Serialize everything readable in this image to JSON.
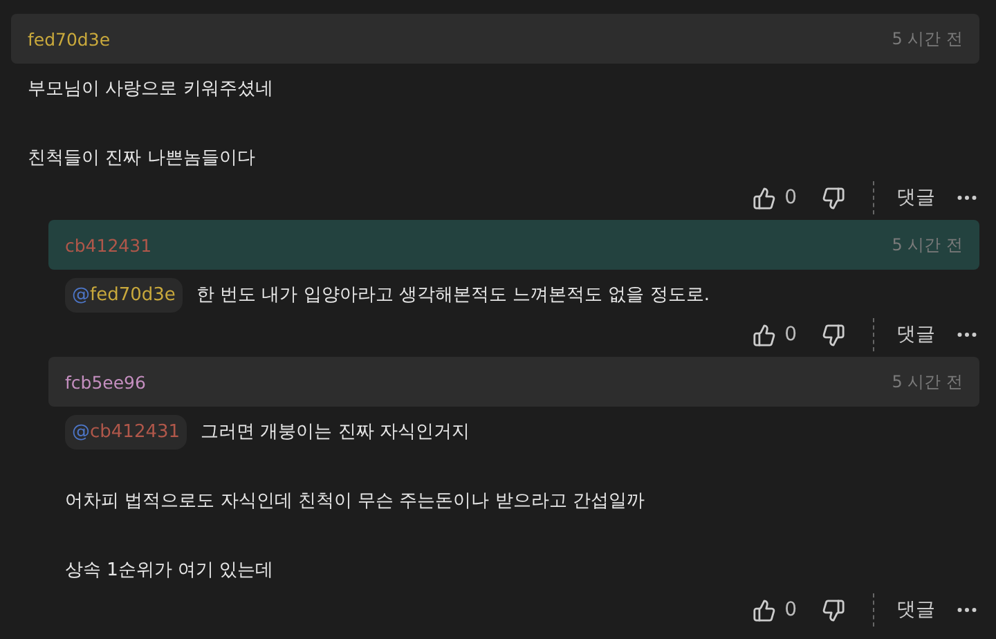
{
  "comments": [
    {
      "author": "fed70d3e",
      "color": "#c9a93c",
      "time": "5 시간 전",
      "highlighted": false,
      "reply": false,
      "paragraphs": [
        "부모님이 사랑으로 키워주셨네",
        "친척들이 진짜 나쁜놈들이다"
      ],
      "likes": "0",
      "reply_label": "댓글"
    },
    {
      "author": "cb412431",
      "color": "#b0574a",
      "time": "5 시간 전",
      "highlighted": true,
      "reply": true,
      "mention": {
        "prefix": "@",
        "user": "fed70d3e",
        "color": "#c9a93c"
      },
      "paragraphs": [
        "한 번도 내가 입양아라고 생각해본적도 느껴본적도 없을 정도로."
      ],
      "likes": "0",
      "reply_label": "댓글"
    },
    {
      "author": "fcb5ee96",
      "color": "#c58fc0",
      "time": "5 시간 전",
      "highlighted": false,
      "reply": true,
      "mention": {
        "prefix": "@",
        "user": "cb412431",
        "color": "#b0574a"
      },
      "paragraphs": [
        "그러면 개붕이는 진짜 자식인거지",
        "어차피 법적으로도 자식인데 친척이 무슨 주는돈이나 받으라고 간섭일까",
        "상속 1순위가 여기 있는데"
      ],
      "likes": "0",
      "reply_label": "댓글"
    }
  ]
}
